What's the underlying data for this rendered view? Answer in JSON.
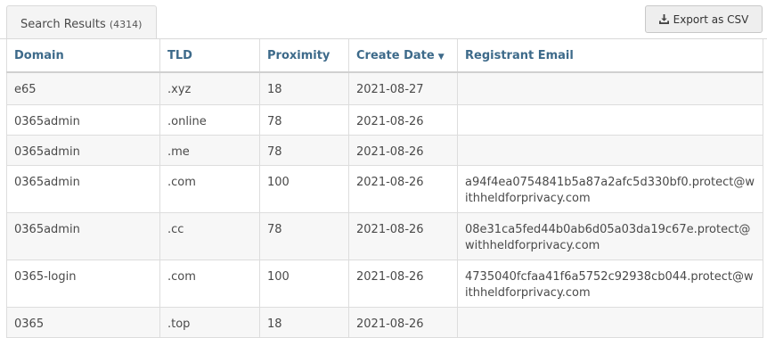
{
  "tab": {
    "label": "Search Results",
    "count": "(4314)"
  },
  "export_button": {
    "label": "Export as CSV",
    "icon": "download-icon"
  },
  "columns": [
    {
      "label": "Domain"
    },
    {
      "label": "TLD"
    },
    {
      "label": "Proximity"
    },
    {
      "label": "Create Date",
      "sort_indicator": "▼"
    },
    {
      "label": "Registrant Email"
    }
  ],
  "rows": [
    {
      "domain": "e65",
      "tld": ".xyz",
      "proximity": "18",
      "create_date": "2021-08-27",
      "email": ""
    },
    {
      "domain": "0365admin",
      "tld": ".online",
      "proximity": "78",
      "create_date": "2021-08-26",
      "email": ""
    },
    {
      "domain": "0365admin",
      "tld": ".me",
      "proximity": "78",
      "create_date": "2021-08-26",
      "email": ""
    },
    {
      "domain": "0365admin",
      "tld": ".com",
      "proximity": "100",
      "create_date": "2021-08-26",
      "email": "a94f4ea0754841b5a87a2afc5d330bf0.protect@withheldforprivacy.com"
    },
    {
      "domain": "0365admin",
      "tld": ".cc",
      "proximity": "78",
      "create_date": "2021-08-26",
      "email": "08e31ca5fed44b0ab6d05a03da19c67e.protect@withheldforprivacy.com"
    },
    {
      "domain": "0365-login",
      "tld": ".com",
      "proximity": "100",
      "create_date": "2021-08-26",
      "email": "4735040fcfaa41f6a5752c92938cb044.protect@withheldforprivacy.com"
    },
    {
      "domain": "0365",
      "tld": ".top",
      "proximity": "18",
      "create_date": "2021-08-26",
      "email": ""
    }
  ]
}
